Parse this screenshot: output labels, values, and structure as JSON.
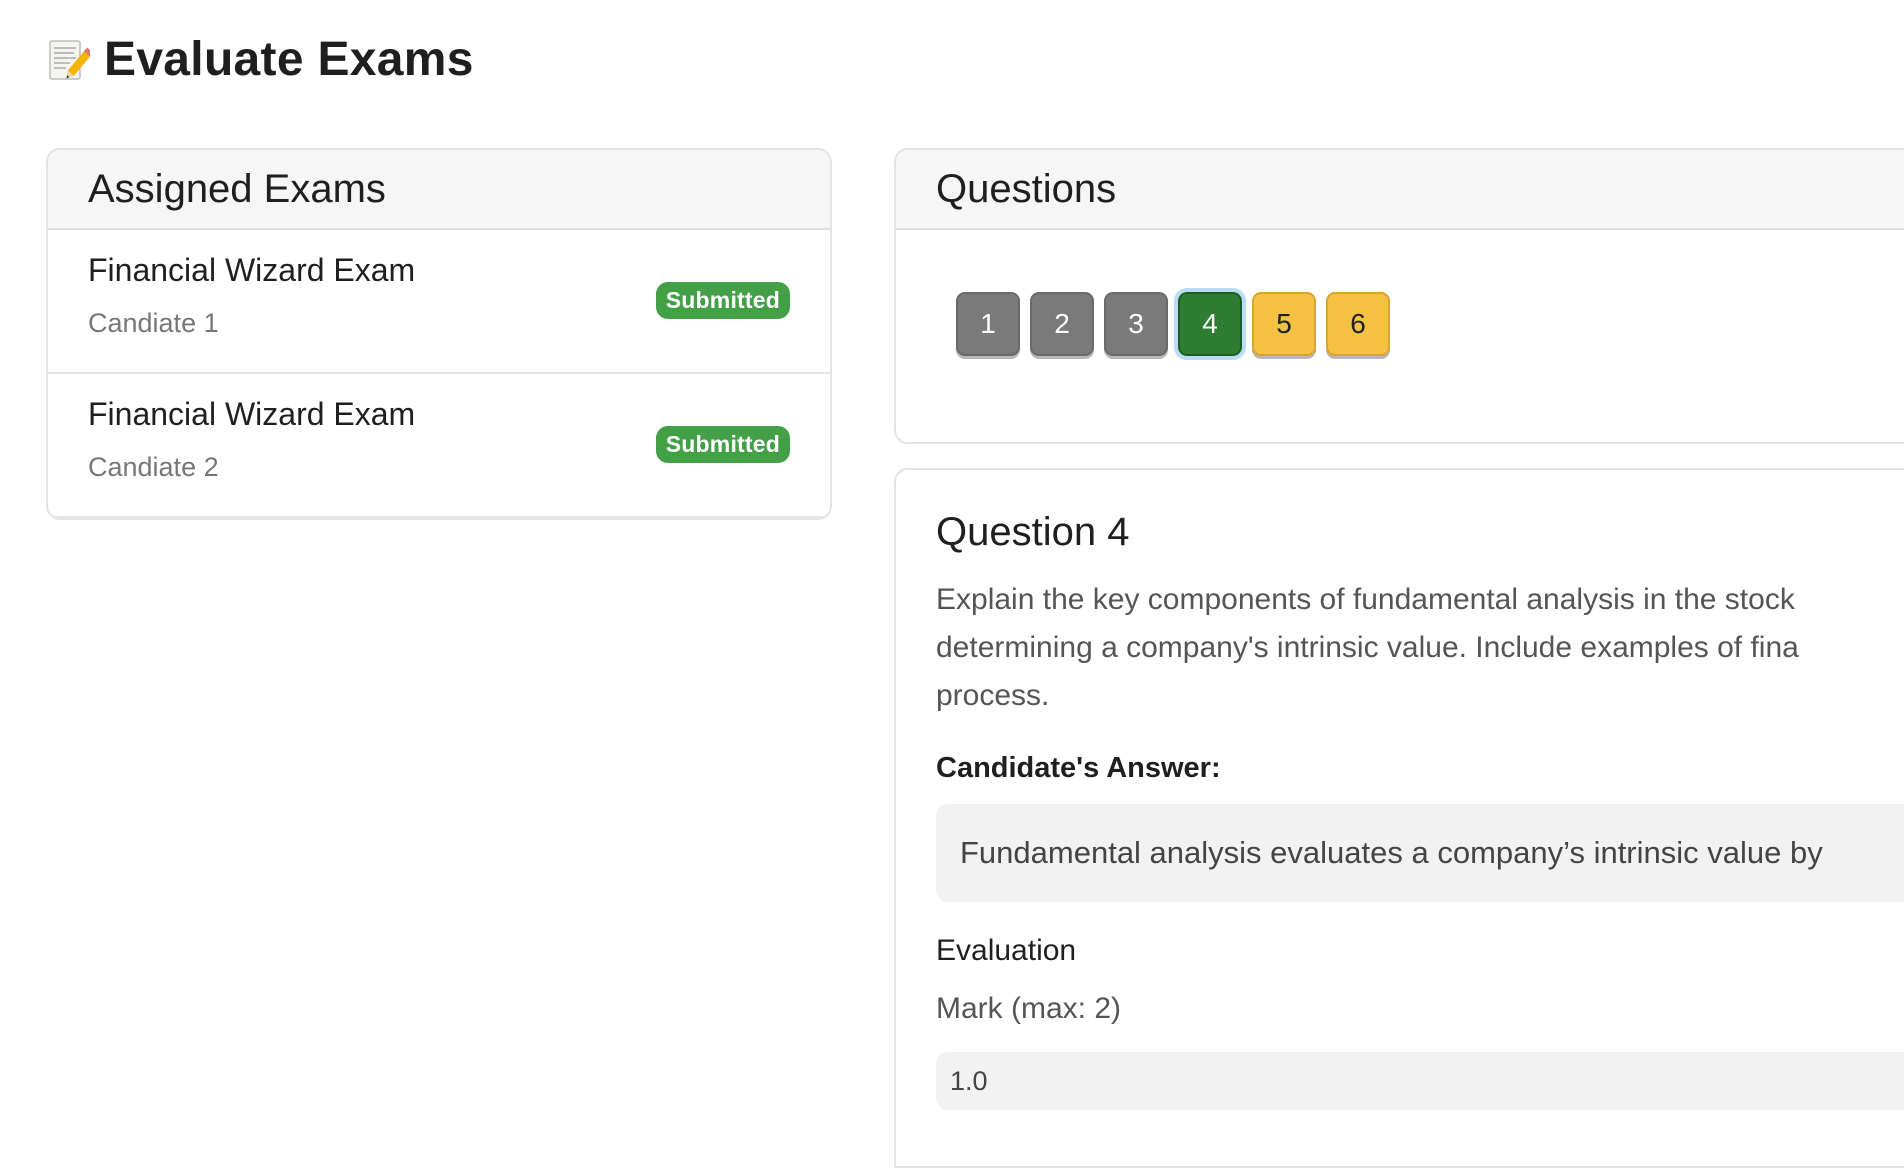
{
  "page": {
    "title": "Evaluate Exams",
    "title_icon": "memo-pencil-icon"
  },
  "assigned_exams": {
    "heading": "Assigned Exams",
    "items": [
      {
        "exam": "Financial Wizard Exam",
        "candidate": "Candiate 1",
        "status": "Submitted"
      },
      {
        "exam": "Financial Wizard Exam",
        "candidate": "Candiate 2",
        "status": "Submitted"
      }
    ]
  },
  "questions": {
    "heading": "Questions",
    "buttons": [
      {
        "label": "1",
        "state": "answered"
      },
      {
        "label": "2",
        "state": "answered"
      },
      {
        "label": "3",
        "state": "answered"
      },
      {
        "label": "4",
        "state": "current"
      },
      {
        "label": "5",
        "state": "pending"
      },
      {
        "label": "6",
        "state": "pending"
      }
    ]
  },
  "question_detail": {
    "title": "Question 4",
    "text_lines": [
      "Explain the key components of fundamental analysis in the stock",
      "determining a company's intrinsic value. Include examples of fina",
      "process."
    ],
    "answer_label": "Candidate's Answer:",
    "answer": "Fundamental analysis evaluates a company’s intrinsic value by",
    "evaluation_heading": "Evaluation",
    "mark_label": "Mark (max: 2)",
    "mark_value": "1.0"
  },
  "colors": {
    "submitted_badge": "#43a047",
    "answered": "#7a7a7a",
    "current": "#2e7d32",
    "pending": "#f5c144"
  }
}
